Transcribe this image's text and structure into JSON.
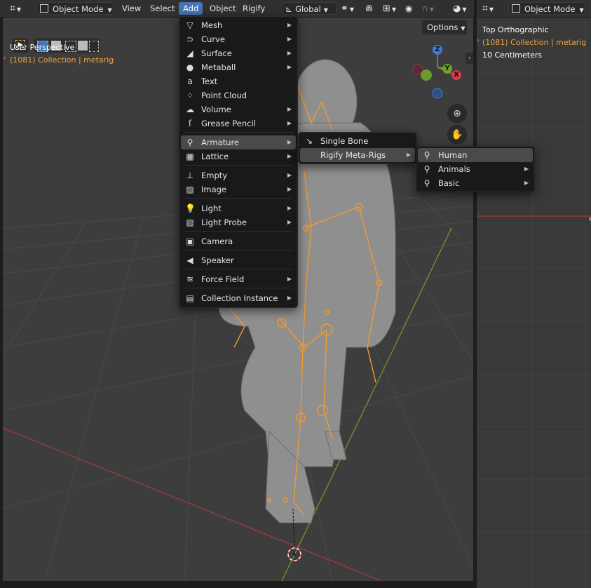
{
  "left_header": {
    "mode": "Object Mode",
    "menus": [
      "View",
      "Select",
      "Add",
      "Object",
      "Rigify"
    ],
    "active_menu": "Add",
    "transform_orientation": "Global"
  },
  "right_header": {
    "mode": "Object Mode"
  },
  "viewport_left": {
    "perspective": "User Perspective",
    "collection": "(1081) Collection | metarig",
    "options": "Options"
  },
  "viewport_right": {
    "perspective": "Top Orthographic",
    "collection": "(1081) Collection | metarig",
    "scale": "10 Centimeters"
  },
  "gizmo": {
    "z": "Z",
    "y": "Y",
    "x": "X"
  },
  "add_menu": [
    {
      "label": "Mesh",
      "icon": "mesh-icon",
      "glyph": "▽",
      "sub": true
    },
    {
      "label": "Curve",
      "icon": "curve-icon",
      "glyph": "⊃",
      "sub": true
    },
    {
      "label": "Surface",
      "icon": "surface-icon",
      "glyph": "◢",
      "sub": true
    },
    {
      "label": "Metaball",
      "icon": "metaball-icon",
      "glyph": "●",
      "sub": true
    },
    {
      "label": "Text",
      "icon": "text-icon",
      "glyph": "a",
      "sub": false
    },
    {
      "label": "Point Cloud",
      "icon": "point-cloud-icon",
      "glyph": "⁘",
      "sub": false
    },
    {
      "label": "Volume",
      "icon": "volume-icon",
      "glyph": "☁",
      "sub": true
    },
    {
      "label": "Grease Pencil",
      "icon": "grease-pencil-icon",
      "glyph": "ſ",
      "sub": true
    },
    {
      "label": "Armature",
      "icon": "armature-icon",
      "glyph": "⚲",
      "sub": true
    },
    {
      "label": "Lattice",
      "icon": "lattice-icon",
      "glyph": "▦",
      "sub": true
    },
    {
      "label": "Empty",
      "icon": "empty-icon",
      "glyph": "⊥",
      "sub": true
    },
    {
      "label": "Image",
      "icon": "image-icon",
      "glyph": "▨",
      "sub": true
    },
    {
      "label": "Light",
      "icon": "light-icon",
      "glyph": "💡",
      "sub": true
    },
    {
      "label": "Light Probe",
      "icon": "light-probe-icon",
      "glyph": "▧",
      "sub": true
    },
    {
      "label": "Camera",
      "icon": "camera-icon",
      "glyph": "▣",
      "sub": false
    },
    {
      "label": "Speaker",
      "icon": "speaker-icon",
      "glyph": "◀",
      "sub": false
    },
    {
      "label": "Force Field",
      "icon": "force-field-icon",
      "glyph": "≋",
      "sub": true
    },
    {
      "label": "Collection Instance",
      "icon": "collection-instance-icon",
      "glyph": "▤",
      "sub": true
    }
  ],
  "armature_menu": [
    {
      "label": "Single Bone",
      "icon": "bone-icon",
      "glyph": "↘",
      "sub": false
    },
    {
      "label": "Rigify Meta-Rigs",
      "icon": "",
      "glyph": "",
      "sub": true
    }
  ],
  "metarigs_menu": [
    {
      "label": "Human",
      "icon": "human-icon",
      "glyph": "⚲",
      "sub": false
    },
    {
      "label": "Animals",
      "icon": "animals-icon",
      "glyph": "⚲",
      "sub": true
    },
    {
      "label": "Basic",
      "icon": "basic-icon",
      "glyph": "⚲",
      "sub": true
    }
  ],
  "colors": {
    "accent": "#4772b3",
    "overlay_orange": "#f0a53c",
    "highlight": "#4a4a4a"
  }
}
